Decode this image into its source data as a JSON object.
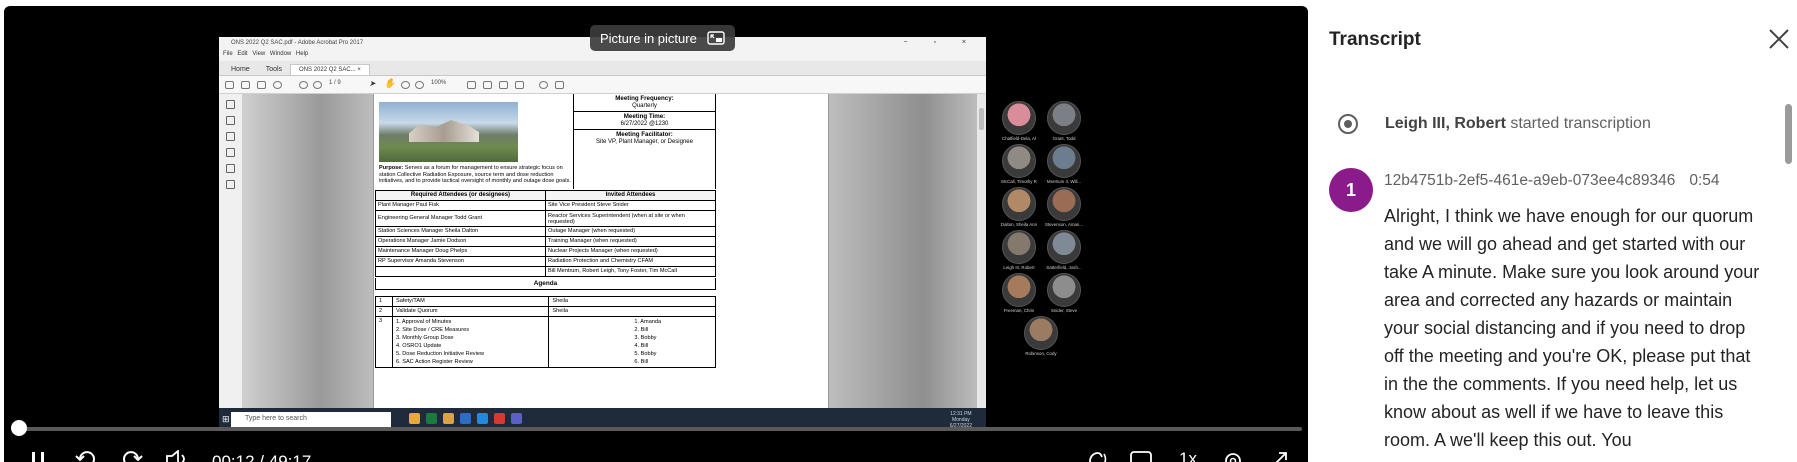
{
  "player": {
    "pip_label": "Picture in picture",
    "current_time": "00:12",
    "time_separator": "/",
    "duration": "49:17",
    "speed": "1x",
    "progress_fraction": 0.004
  },
  "shared_screen": {
    "window_title": "ONS 2022 Q2 SAC.pdf - Adobe Acrobat Pro 2017",
    "menu": "File  Edit  View  Window  Help",
    "tabs": {
      "home": "Home",
      "tools": "Tools",
      "doc": "ONS 2022 Q2 SAC... ×"
    },
    "zoom": "100%",
    "page_indicator": "1 / 9",
    "taskbar": {
      "search_placeholder": "Type here to search",
      "clock_time": "12:31 PM",
      "clock_day": "Monday",
      "clock_date": "6/27/2022"
    },
    "pdf": {
      "meeting_frequency_label": "Meeting Frequency:",
      "meeting_frequency": "Quarterly",
      "meeting_time_label": "Meeting Time:",
      "meeting_time": "6/27/2022 @1230",
      "meeting_facilitator_label": "Meeting Facilitator:",
      "meeting_facilitator": "Site VP, Plant Manager, or Designee",
      "purpose_label": "Purpose:",
      "purpose_text": " Serves as a forum for management to ensure strategic focus on station Collective Radiation Exposure, source term and dose reduction initiatives, and to provide tactical oversight of monthly and outage dose goals.",
      "required_header": "Required Attendees (or designees)",
      "invited_header": "Invited Attendees",
      "attendees": [
        {
          "required": "Plant Manager    Paul Fisk",
          "invited": "Site Vice President    Steve Snider"
        },
        {
          "required": "Engineering General Manager    Todd Grant",
          "invited": "Reactor Services Superintendent (when at site or when requested)"
        },
        {
          "required": "Station Sciences Manager    Sheila Dalton",
          "invited": "Outage Manager (when requested)"
        },
        {
          "required": "Operations Manager    Jamie Dodson",
          "invited": "Training Manager (when requested)"
        },
        {
          "required": "Maintenance Manager    Doug Phelps",
          "invited": "Nuclear Projects Manager (when requested)"
        },
        {
          "required": "RP Supervisor    Amanda Stevenson",
          "invited": "Radiation Protection and Chemistry CFAM"
        },
        {
          "required": "",
          "invited": "Bill Mentrum, Robert Leigh, Tony Foster, Tim McCall"
        }
      ],
      "agenda_title": "Agenda",
      "agenda": [
        {
          "num": "1",
          "item": "Safety/TAM",
          "owner": "Sheila"
        },
        {
          "num": "2",
          "item": "Validate Quorum",
          "owner": "Sheila"
        }
      ],
      "agenda_sub_num": "3",
      "agenda_sub_items": [
        "1.    Approval of Minutes",
        "2.    Site Dose / CRE Measures",
        "3.    Monthly Group Dose",
        "4.    OSRO1 Update",
        "5.    Dose Reduction Initiative Review",
        "6.    SAC Action Register Review"
      ],
      "agenda_sub_owners": [
        "1.    Amanda",
        "2.    Bill",
        "3.    Bobby",
        "4.    Bill",
        "5.    Bobby",
        "6.    Bill"
      ]
    }
  },
  "gallery": [
    {
      "name": "Chatfield-Dela, Al",
      "color": "#d98c9a"
    },
    {
      "name": "Grant, Todd",
      "color": "#7c7f86"
    },
    {
      "name": "McCall, Timothy R",
      "color": "#8f8a84"
    },
    {
      "name": "Mentrum II, Will...",
      "color": "#6b7d8f"
    },
    {
      "name": "Dalton, Sheila Ann",
      "color": "#b08a66"
    },
    {
      "name": "Stevenson, Aman...",
      "color": "#9a6c55"
    },
    {
      "name": "Leigh III, Robert",
      "color": "#84796d"
    },
    {
      "name": "Satterfield, Josh...",
      "color": "#7f8a96"
    },
    {
      "name": "Freeman, Chris",
      "color": "#a57b5c"
    },
    {
      "name": "Snider, Steve",
      "color": "#8d8d8d"
    },
    {
      "name": "Robinson, Cody",
      "color": "#9b7c63"
    }
  ],
  "transcript": {
    "title": "Transcript",
    "event_name": "Leigh III, Robert",
    "event_action": " started transcription",
    "entry": {
      "avatar_initial": "1",
      "avatar_color": "#8b1a8b",
      "speaker": "12b4751b-2ef5-461e-a9eb-073ee4c89346",
      "timestamp": "0:54",
      "text": "Alright, I think we have enough for our quorum and we will go ahead and get started with our take A minute. Make sure you look around your area and corrected any hazards or maintain your social distancing and if you need to drop off the meeting and you're OK, please put that in the the comments. If you need help, let us know about as well if we have to leave this room. A we'll keep this out. You"
    }
  }
}
